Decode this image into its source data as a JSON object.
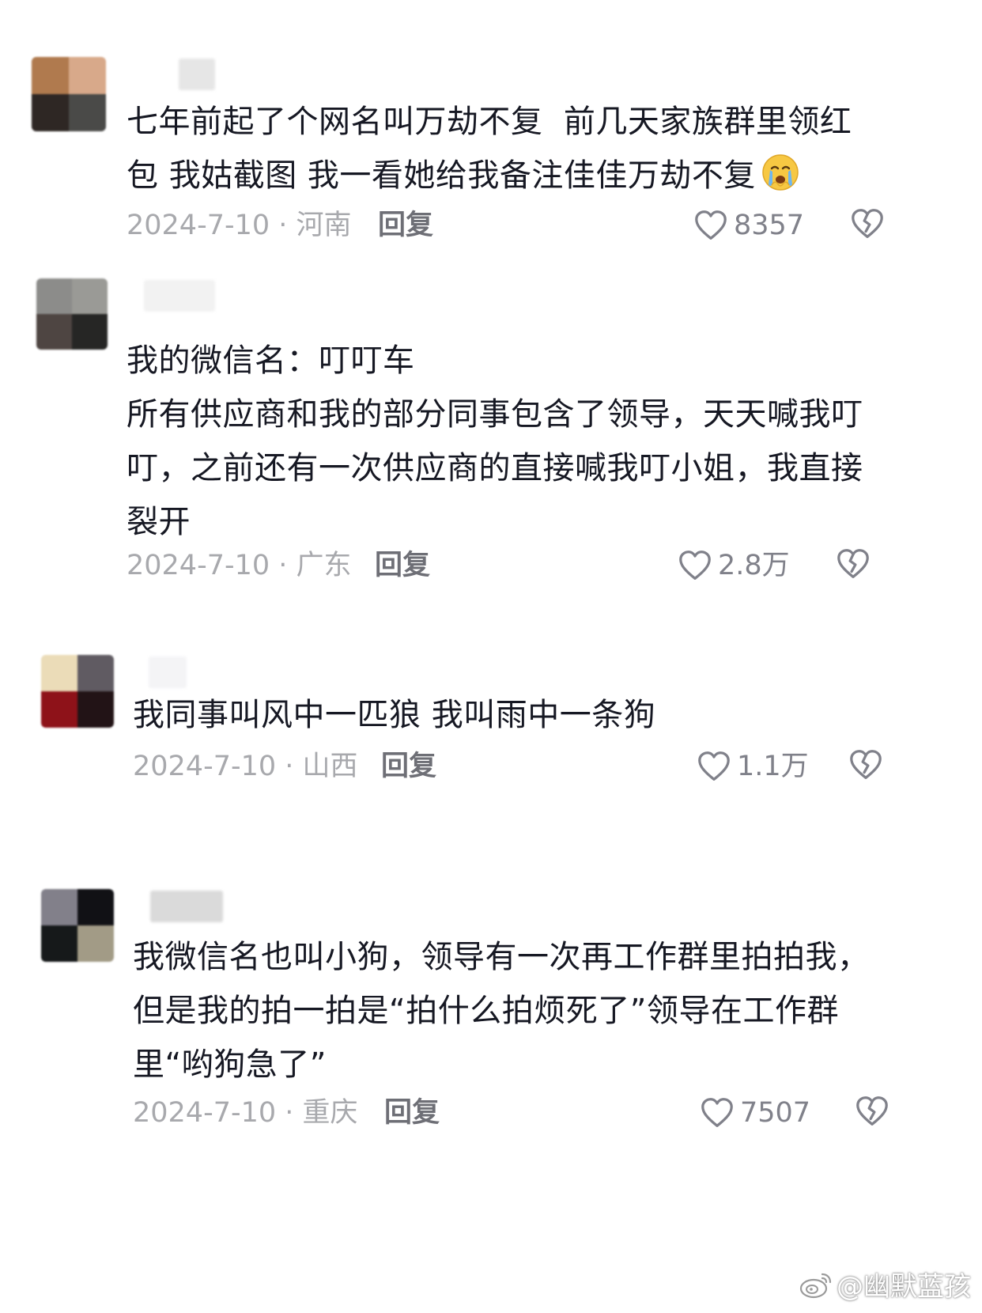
{
  "comments": [
    {
      "avatar_colors": [
        "#b07a4e",
        "#d8a98a",
        "#2e2724",
        "#4a4a48"
      ],
      "username_color": "#e6e6e6",
      "text": "七年前起了个网名叫万劫不复  前几天家族群里领红包 我姑截图 我一看她给我备注佳佳万劫不复",
      "emoji": "crying-face-emoji",
      "date": "2024-7-10 · 河南",
      "reply": "回复",
      "likes": "8357"
    },
    {
      "avatar_colors": [
        "#8c8c8a",
        "#9a9a96",
        "#4e4542",
        "#262625"
      ],
      "username_color": "#f2f2f2",
      "text": "我的微信名：叮叮车\n所有供应商和我的部分同事包含了领导，天天喊我叮叮，之前还有一次供应商的直接喊我叮小姐，我直接裂开",
      "date": "2024-7-10 · 广东",
      "reply": "回复",
      "likes": "2.8万"
    },
    {
      "avatar_colors": [
        "#ebdcb8",
        "#605b62",
        "#8e1219",
        "#221316"
      ],
      "username_color": "#f4f4f6",
      "text": "我同事叫风中一匹狼 我叫雨中一条狗",
      "date": "2024-7-10 · 山西",
      "reply": "回复",
      "likes": "1.1万"
    },
    {
      "avatar_colors": [
        "#82808a",
        "#111115",
        "#16191a",
        "#a29b86"
      ],
      "username_color": "#dadada",
      "text": "我微信名也叫小狗，领导有一次再工作群里拍拍我，但是我的拍一拍是“拍什么拍烦死了”领导在工作群里“哟狗急了”",
      "date": "2024-7-10 · 重庆",
      "reply": "回复",
      "likes": "7507"
    }
  ],
  "watermark": {
    "icon": "weibo-icon",
    "text": "@幽默蓝孩"
  },
  "colors": {
    "text": "#161823",
    "meta": "#a8a9ad",
    "reply": "#6e6f76",
    "icon": "#80818a"
  }
}
